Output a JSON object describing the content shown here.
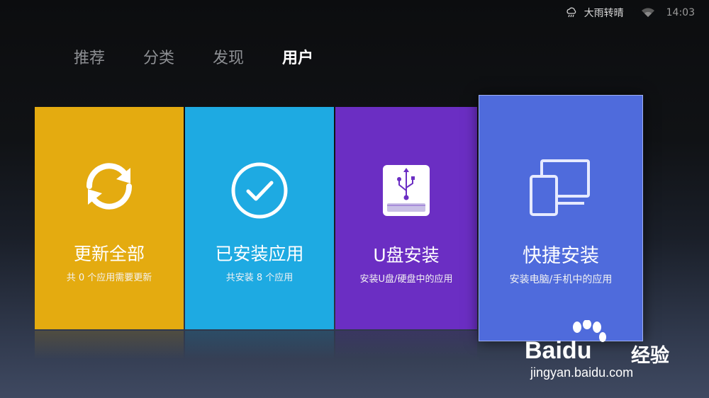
{
  "status": {
    "weather": "大雨转晴",
    "time": "14:03"
  },
  "tabs": [
    {
      "label": "推荐",
      "active": false
    },
    {
      "label": "分类",
      "active": false
    },
    {
      "label": "发现",
      "active": false
    },
    {
      "label": "用户",
      "active": true
    }
  ],
  "tiles": [
    {
      "title": "更新全部",
      "subtitle": "共 0 个应用需要更新",
      "icon": "refresh-icon",
      "color": "#e4ab10"
    },
    {
      "title": "已安装应用",
      "subtitle": "共安装 8 个应用",
      "icon": "check-circle-icon",
      "color": "#1eaae2"
    },
    {
      "title": "U盘安装",
      "subtitle": "安装U盘/硬盘中的应用",
      "icon": "usb-drive-icon",
      "color": "#6b2ec3"
    },
    {
      "title": "快捷安装",
      "subtitle": "安装电脑/手机中的应用",
      "icon": "devices-icon",
      "color": "#4f6bdc",
      "focused": true
    }
  ],
  "watermark": {
    "brand_bai": "Bai",
    "brand_du": "du",
    "brand_jy": "经验",
    "url": "jingyan.baidu.com"
  }
}
